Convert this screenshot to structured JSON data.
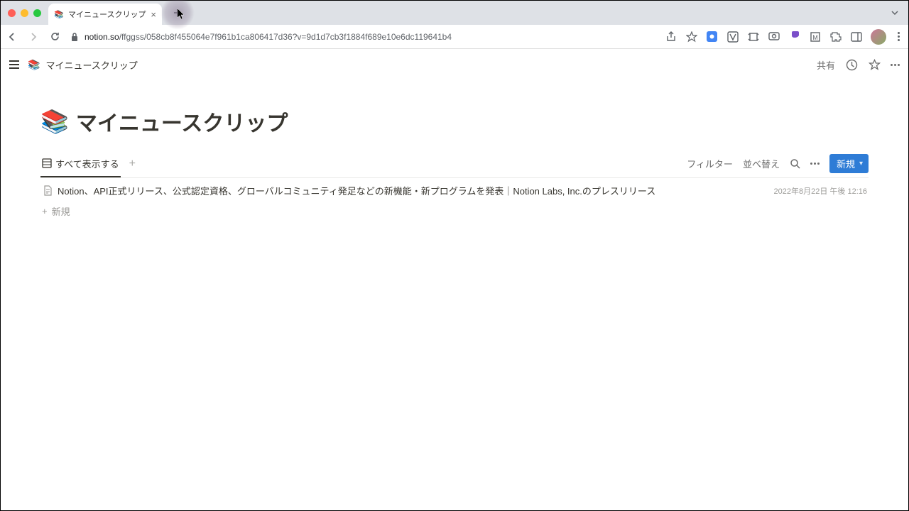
{
  "browser": {
    "tab_title": "マイニュースクリップ",
    "url_domain": "notion.so",
    "url_path": "/ffggss/058cb8f455064e7f961b1ca806417d36?v=9d1d7cb3f1884f689e10e6dc119641b4"
  },
  "notion": {
    "topbar": {
      "breadcrumb": "マイニュースクリップ",
      "share": "共有"
    },
    "page": {
      "emoji": "📚",
      "title": "マイニュースクリップ"
    },
    "view": {
      "tab_label": "すべて表示する",
      "filter": "フィルター",
      "sort": "並べ替え",
      "new_button": "新規"
    },
    "rows": [
      {
        "title": "Notion、API正式リリース、公式認定資格、グローバルコミュニティ発足などの新機能・新プログラムを発表｜Notion Labs, Inc.のプレスリリース",
        "date": "2022年8月22日 午後 12:16"
      }
    ],
    "add_row": "新規"
  }
}
